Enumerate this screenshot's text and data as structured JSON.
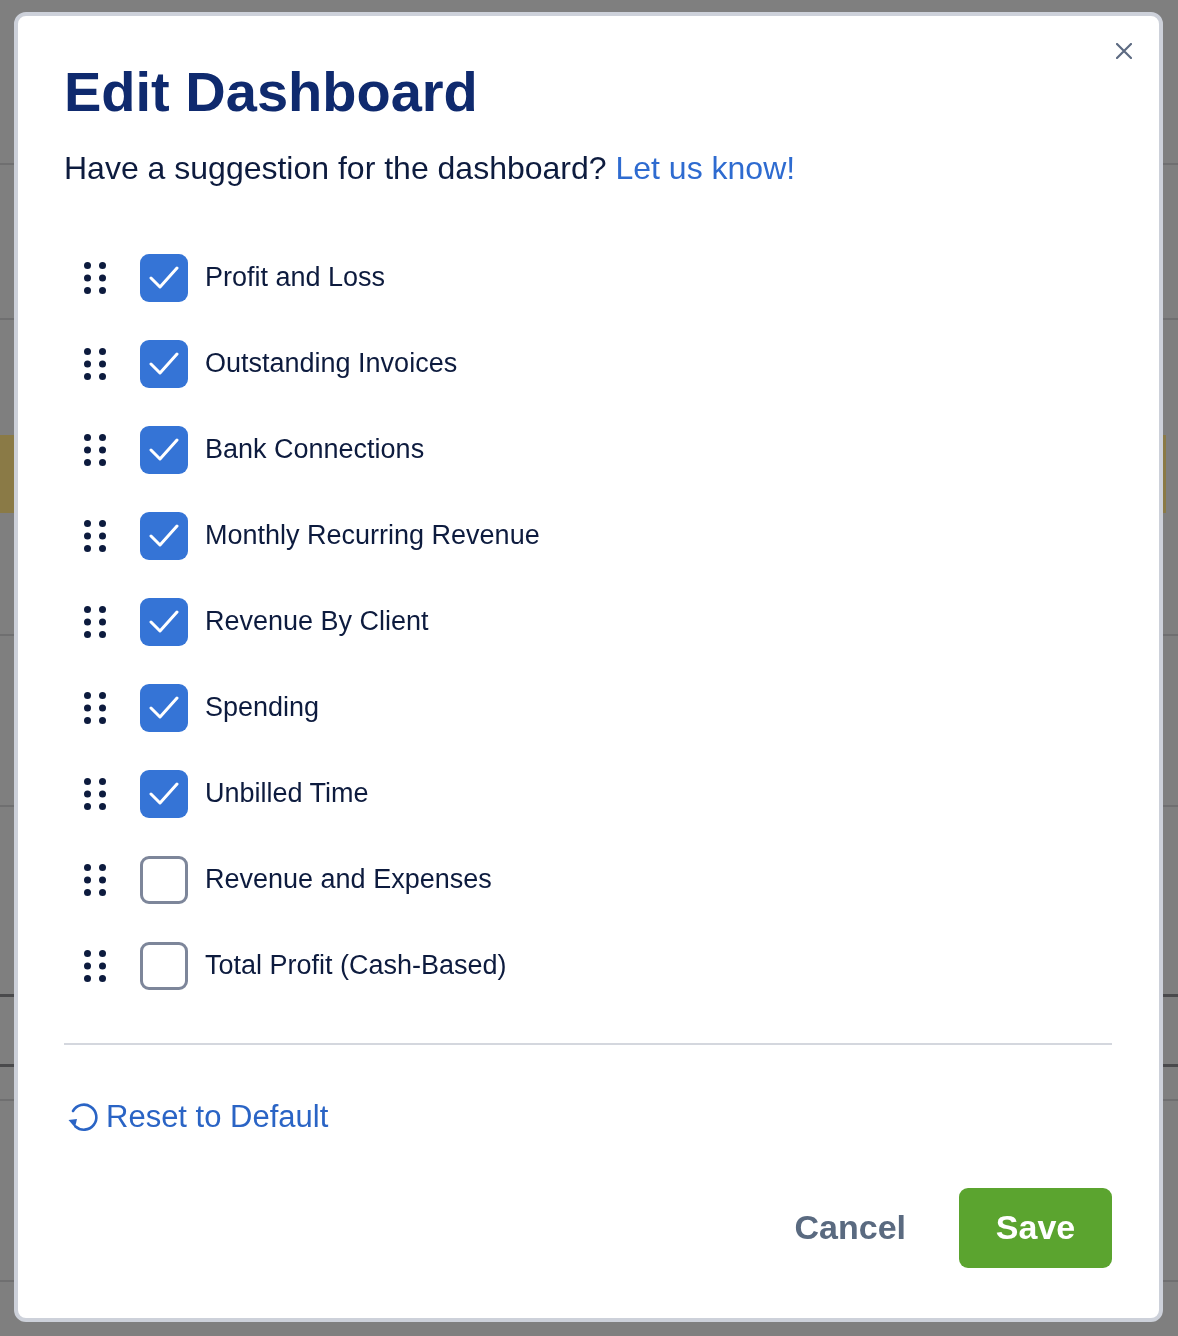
{
  "dialog": {
    "title": "Edit Dashboard",
    "subtitle": "Have a suggestion for the dashboard?",
    "link": "Let us know!",
    "items": [
      {
        "label": "Profit and Loss",
        "checked": true
      },
      {
        "label": "Outstanding Invoices",
        "checked": true
      },
      {
        "label": "Bank Connections",
        "checked": true
      },
      {
        "label": "Monthly Recurring Revenue",
        "checked": true
      },
      {
        "label": "Revenue By Client",
        "checked": true
      },
      {
        "label": "Spending",
        "checked": true
      },
      {
        "label": "Unbilled Time",
        "checked": true
      },
      {
        "label": "Revenue and Expenses",
        "checked": false
      },
      {
        "label": "Total Profit (Cash-Based)",
        "checked": false
      }
    ],
    "reset": "Reset to Default",
    "buttons": [
      {
        "label": "Cancel",
        "kind": "secondary"
      },
      {
        "label": "Save",
        "kind": "primary"
      }
    ]
  }
}
